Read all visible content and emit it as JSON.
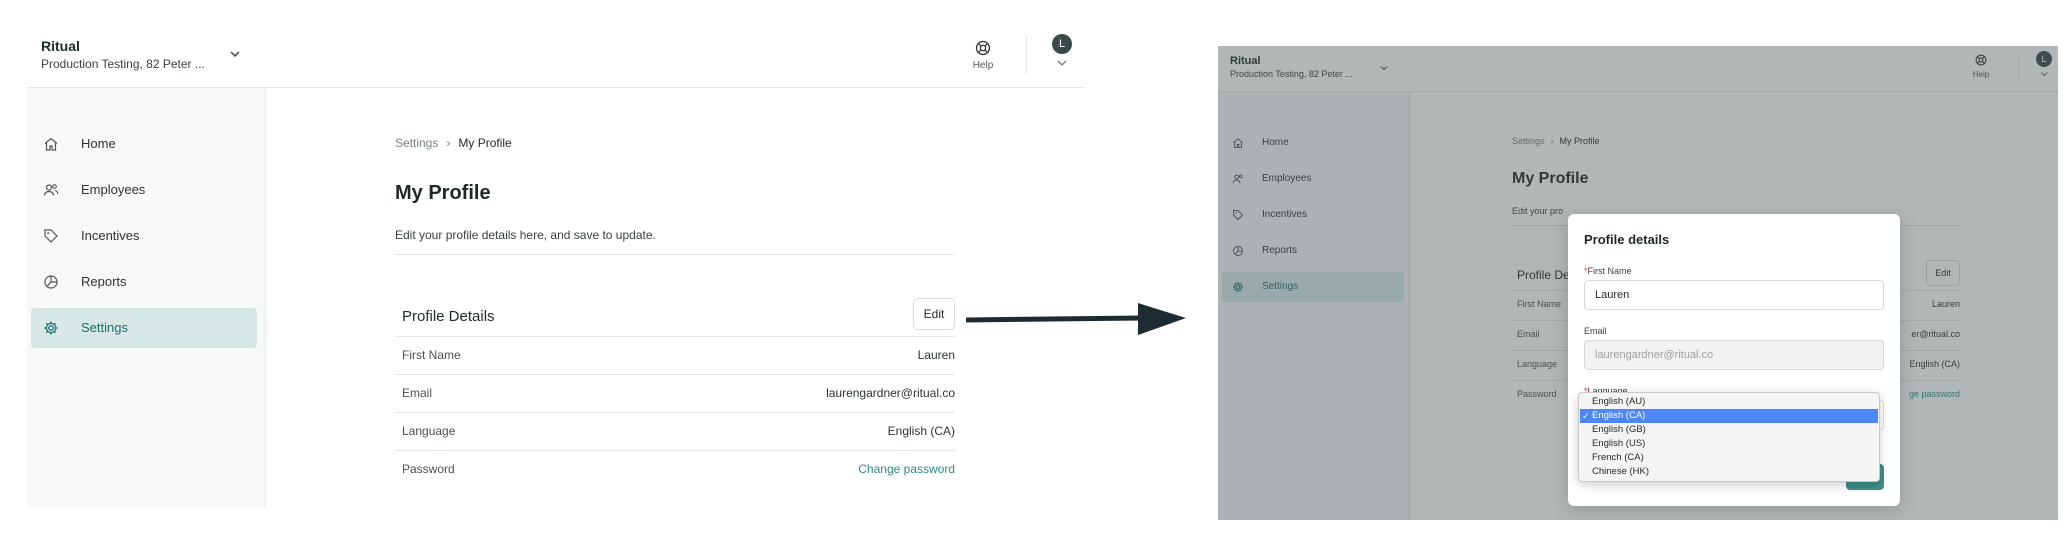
{
  "org": {
    "name": "Ritual",
    "location": "Production Testing, 82 Peter ..."
  },
  "nav": [
    {
      "label": "Home",
      "icon": "home-icon"
    },
    {
      "label": "Employees",
      "icon": "users-icon"
    },
    {
      "label": "Incentives",
      "icon": "tag-icon"
    },
    {
      "label": "Reports",
      "icon": "pie-chart-icon"
    },
    {
      "label": "Settings",
      "icon": "gear-icon",
      "active": true
    }
  ],
  "topbar": {
    "help_label": "Help",
    "avatar_initial": "L"
  },
  "breadcrumb": {
    "parent": "Settings",
    "separator": "›",
    "current": "My Profile"
  },
  "page": {
    "title": "My Profile",
    "subtitle": "Edit your profile details here, and save to update.",
    "subtitle_truncated": "Edit your pro"
  },
  "profile_card": {
    "title": "Profile Details",
    "title_truncated": "Profile De",
    "edit_label": "Edit",
    "rows": [
      {
        "label": "First Name",
        "value": "Lauren"
      },
      {
        "label": "Email",
        "value": "laurengardner@ritual.co",
        "value_truncated": "er@ritual.co"
      },
      {
        "label": "Language",
        "value": "English (CA)"
      },
      {
        "label": "Password",
        "value": "Change password",
        "value_truncated": "ge password",
        "is_link": true
      }
    ]
  },
  "modal": {
    "title": "Profile details",
    "first_name_label": "First Name",
    "first_name_value": "Lauren",
    "email_label": "Email",
    "email_value": "laurengardner@ritual.co",
    "language_label": "Language",
    "required_mark": "*",
    "language_options": [
      "English (AU)",
      "English (CA)",
      "English (GB)",
      "English (US)",
      "French (CA)",
      "Chinese (HK)"
    ],
    "language_selected": "English (CA)",
    "check_mark": "✓"
  },
  "colors": {
    "accent": "#2b8a85",
    "active_nav_bg": "#d6e7e6",
    "dropdown_selected": "#4d86f5",
    "arrow": "#1f2b33"
  }
}
